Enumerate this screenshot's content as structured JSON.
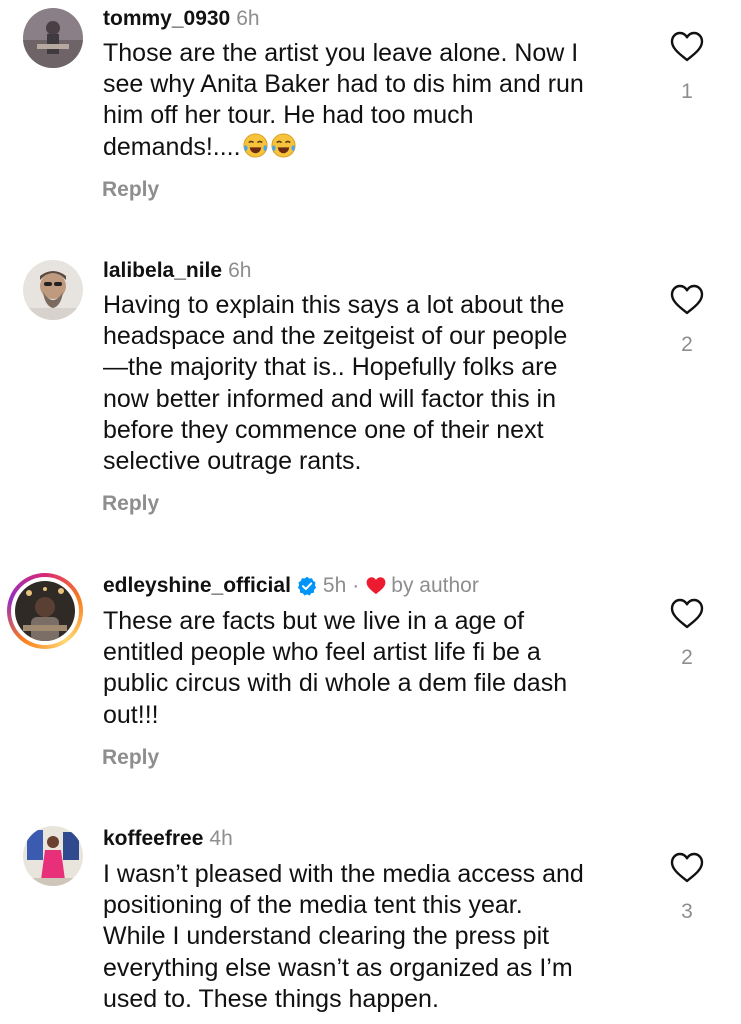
{
  "comments": [
    {
      "username": "tommy_0930",
      "time": "6h",
      "text": "Those are the artist you leave alone. Now I\nsee why Anita Baker had to dis him and run\nhim off her tour. He had too much\ndemands!....",
      "emoji": [
        "joy-emoji",
        "joy-emoji"
      ],
      "likes": "1",
      "reply_label": "Reply"
    },
    {
      "username": "lalibela_nile",
      "time": "6h",
      "text": "Having to explain this says a lot about the\nheadspace and the zeitgeist of our people\n—the majority that is.. Hopefully folks are\nnow better informed and will factor this in\nbefore they commence one of their next\nselective outrage rants.",
      "likes": "2",
      "reply_label": "Reply"
    },
    {
      "username": "edleyshine_official",
      "time": "5h",
      "verified": true,
      "separator": "·",
      "author_badge": "by author",
      "text": "These are facts but we live in a age of\nentitled people who feel artist life fi be a\npublic circus with di whole a dem file dash\nout!!!",
      "likes": "2",
      "reply_label": "Reply"
    },
    {
      "username": "koffeefree",
      "time": "4h",
      "text": "I wasn’t pleased with the media access and\npositioning of the media tent this year.\nWhile I understand clearing the press pit\neverything else wasn’t as organized as I’m\nused to.  These things happen.",
      "likes": "3"
    }
  ],
  "icons": {
    "like": "heart-outline-icon",
    "verified": "verified-badge-icon",
    "author_like": "heart-filled-icon"
  },
  "colors": {
    "text": "#111111",
    "muted": "#8e8e8e",
    "verified": "#0095f6",
    "author_heart": "#ed1b2f"
  }
}
